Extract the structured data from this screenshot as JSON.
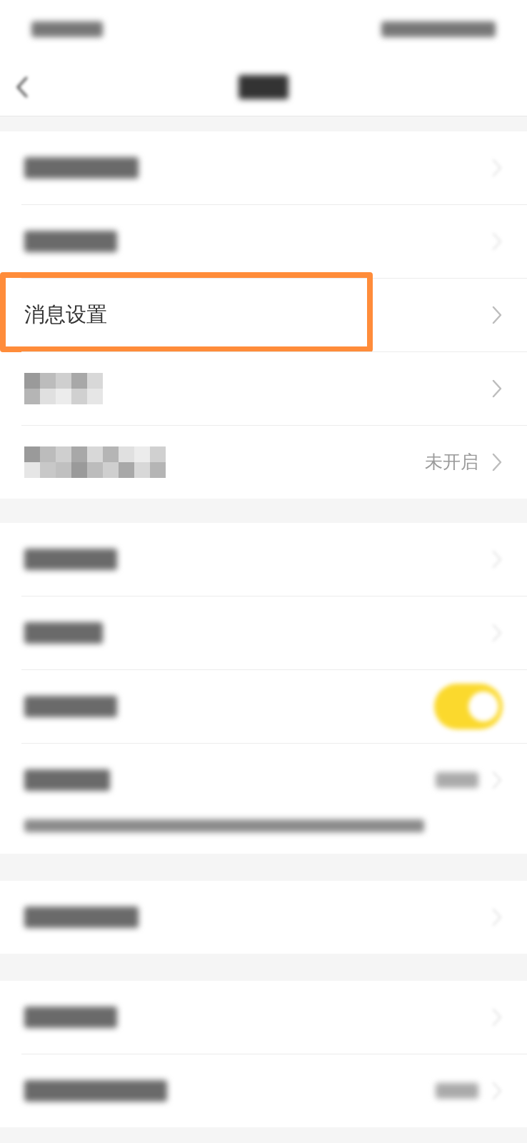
{
  "status_bar": {
    "kind": "blurred"
  },
  "header": {
    "back": true
  },
  "sections": [
    {
      "items": [
        {
          "kind": "blurred",
          "chevron": true,
          "highlighted": false
        },
        {
          "kind": "blurred",
          "chevron": true,
          "highlighted": false
        },
        {
          "kind": "text",
          "label": "消息设置",
          "chevron": true,
          "highlighted": true
        },
        {
          "kind": "mosaic",
          "chevron": true,
          "highlighted": false
        },
        {
          "kind": "mosaic",
          "value": "未开启",
          "chevron": true,
          "highlighted": false
        }
      ]
    },
    {
      "items": [
        {
          "kind": "blurred",
          "chevron": true,
          "highlighted": false
        },
        {
          "kind": "blurred",
          "chevron": true,
          "highlighted": false
        },
        {
          "kind": "blurred",
          "chevron": false,
          "toggle": {
            "on": true
          },
          "highlighted": false
        },
        {
          "kind": "blurred",
          "chevron": true,
          "blurred_value": true,
          "highlighted": false
        },
        {
          "kind": "caption"
        }
      ]
    },
    {
      "items": [
        {
          "kind": "blurred",
          "chevron": true,
          "highlighted": false
        }
      ]
    },
    {
      "items": [
        {
          "kind": "blurred",
          "chevron": true,
          "highlighted": false
        },
        {
          "kind": "blurred",
          "chevron": true,
          "blurred_value": true,
          "highlighted": false
        }
      ]
    }
  ]
}
